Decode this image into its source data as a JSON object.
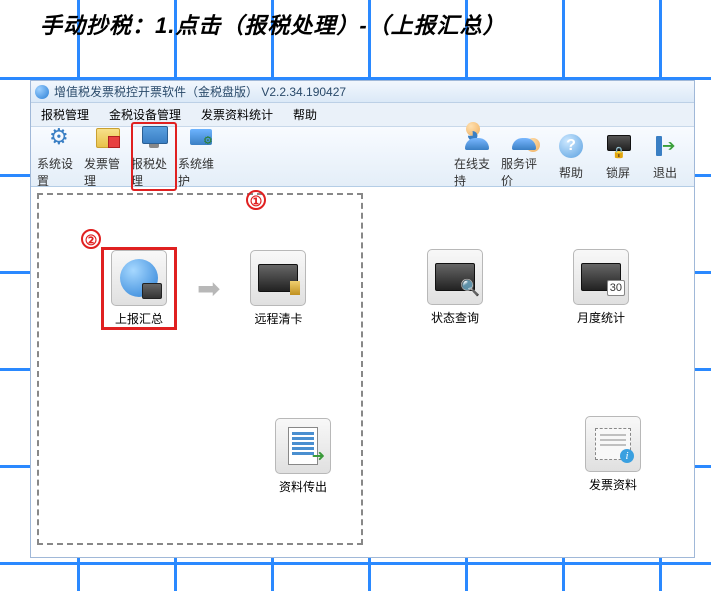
{
  "instruction": "手动抄税：1.点击（报税处理）-（上报汇总）",
  "window": {
    "title": "增值税发票税控开票软件（金税盘版）  V2.2.34.190427"
  },
  "menu": {
    "tax_mgmt": "报税管理",
    "device_mgmt": "金税设备管理",
    "invoice_stats": "发票资料统计",
    "help": "帮助"
  },
  "toolbar": {
    "sys_settings": "系统设置",
    "invoice_mgmt": "发票管理",
    "tax_process": "报税处理",
    "sys_maint": "系统维护",
    "online_support": "在线支持",
    "service_rating": "服务评价",
    "help": "帮助",
    "lock": "锁屏",
    "exit": "退出"
  },
  "annotations": {
    "step1": "①",
    "step2": "②"
  },
  "buttons": {
    "report_summary": "上报汇总",
    "remote_clear": "远程清卡",
    "data_export": "资料传出",
    "status_query": "状态查询",
    "monthly_stats": "月度统计",
    "invoice_data": "发票资料"
  }
}
